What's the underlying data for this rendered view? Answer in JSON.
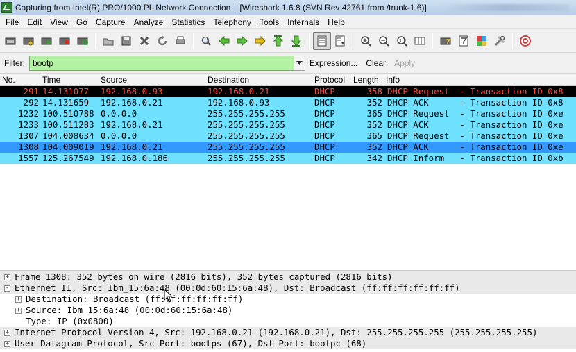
{
  "window": {
    "title": "Capturing from Intel(R) PRO/1000 PL Network Connection",
    "subtitle": "[Wireshark 1.6.8  (SVN Rev 42761 from /trunk-1.6)]"
  },
  "menu": [
    {
      "label": "File",
      "u": "F",
      "rest": "ile"
    },
    {
      "label": "Edit",
      "u": "E",
      "rest": "dit"
    },
    {
      "label": "View",
      "u": "V",
      "rest": "iew"
    },
    {
      "label": "Go",
      "u": "G",
      "rest": "o"
    },
    {
      "label": "Capture",
      "u": "C",
      "rest": "apture"
    },
    {
      "label": "Analyze",
      "u": "A",
      "rest": "nalyze"
    },
    {
      "label": "Statistics",
      "u": "S",
      "rest": "tatistics"
    },
    {
      "label": "Telephony",
      "u": "",
      "rest": "Telephony"
    },
    {
      "label": "Tools",
      "u": "T",
      "rest": "ools"
    },
    {
      "label": "Internals",
      "u": "I",
      "rest": "nternals"
    },
    {
      "label": "Help",
      "u": "H",
      "rest": "elp"
    }
  ],
  "filter": {
    "label": "Filter:",
    "value": "bootp",
    "expression": "Expression...",
    "clear": "Clear",
    "apply": "Apply"
  },
  "columns": {
    "no": "No.",
    "time": "Time",
    "source": "Source",
    "destination": "Destination",
    "protocol": "Protocol",
    "length": "Length",
    "info": "Info"
  },
  "colors": {
    "row_dhcp": "#70e0ff",
    "row_selected": "#3399ff",
    "row_marked_bg": "#000000",
    "row_marked_fg": "#ff4a3a",
    "filter_bg": "#b3f2a3"
  },
  "packets": [
    {
      "no": "291",
      "time": "14.131077",
      "src": "192.168.0.93",
      "dst": "192.168.0.21",
      "proto": "DHCP",
      "len": "358",
      "info": "DHCP Request  - Transaction ID 0x8",
      "style": "marked"
    },
    {
      "no": "292",
      "time": "14.131659",
      "src": "192.168.0.21",
      "dst": "192.168.0.93",
      "proto": "DHCP",
      "len": "352",
      "info": "DHCP ACK      - Transaction ID 0x8",
      "style": "normal"
    },
    {
      "no": "1232",
      "time": "100.510788",
      "src": "0.0.0.0",
      "dst": "255.255.255.255",
      "proto": "DHCP",
      "len": "365",
      "info": "DHCP Request  - Transaction ID 0xe",
      "style": "normal"
    },
    {
      "no": "1233",
      "time": "100.511283",
      "src": "192.168.0.21",
      "dst": "255.255.255.255",
      "proto": "DHCP",
      "len": "352",
      "info": "DHCP ACK      - Transaction ID 0xe",
      "style": "normal"
    },
    {
      "no": "1307",
      "time": "104.008634",
      "src": "0.0.0.0",
      "dst": "255.255.255.255",
      "proto": "DHCP",
      "len": "365",
      "info": "DHCP Request  - Transaction ID 0xe",
      "style": "normal"
    },
    {
      "no": "1308",
      "time": "104.009019",
      "src": "192.168.0.21",
      "dst": "255.255.255.255",
      "proto": "DHCP",
      "len": "352",
      "info": "DHCP ACK      - Transaction ID 0xe",
      "style": "selected"
    },
    {
      "no": "1557",
      "time": "125.267549",
      "src": "192.168.0.186",
      "dst": "255.255.255.255",
      "proto": "DHCP",
      "len": "342",
      "info": "DHCP Inform   - Transaction ID 0xb",
      "style": "normal"
    }
  ],
  "details": [
    {
      "text": "Frame 1308: 352 bytes on wire (2816 bits), 352 bytes captured (2816 bits)",
      "expander": "+",
      "indent": 0,
      "grey": true
    },
    {
      "text": "Ethernet II, Src: Ibm_15:6a:48 (00:0d:60:15:6a:48), Dst: Broadcast (ff:ff:ff:ff:ff:ff)",
      "expander": "-",
      "indent": 0,
      "grey": true
    },
    {
      "text": "Destination: Broadcast (ff:ff:ff:ff:ff:ff)",
      "expander": "+",
      "indent": 1,
      "grey": false
    },
    {
      "text": "Source: Ibm_15:6a:48 (00:0d:60:15:6a:48)",
      "expander": "+",
      "indent": 1,
      "grey": false
    },
    {
      "text": "Type: IP (0x0800)",
      "expander": "",
      "indent": 1,
      "grey": false
    },
    {
      "text": "Internet Protocol Version 4, Src: 192.168.0.21 (192.168.0.21), Dst: 255.255.255.255 (255.255.255.255)",
      "expander": "+",
      "indent": 0,
      "grey": true
    },
    {
      "text": "User Datagram Protocol, Src Port: bootps (67), Dst Port: bootpc (68)",
      "expander": "+",
      "indent": 0,
      "grey": true
    }
  ],
  "toolbar_icons": [
    "interfaces-icon",
    "options-icon",
    "start-capture-icon",
    "stop-capture-icon",
    "restart-capture-icon",
    "sep",
    "open-icon",
    "save-icon",
    "close-file-icon",
    "reload-icon",
    "print-icon",
    "sep",
    "find-icon",
    "back-icon",
    "forward-icon",
    "goto-icon",
    "first-packet-icon",
    "last-packet-icon",
    "sep",
    "colorize-icon",
    "autoscroll-icon",
    "sep",
    "zoom-in-icon",
    "zoom-out-icon",
    "normal-size-icon",
    "resize-columns-icon",
    "sep",
    "capture-filters-icon",
    "display-filters-icon",
    "coloring-rules-icon",
    "preferences-icon",
    "sep",
    "help-icon"
  ]
}
